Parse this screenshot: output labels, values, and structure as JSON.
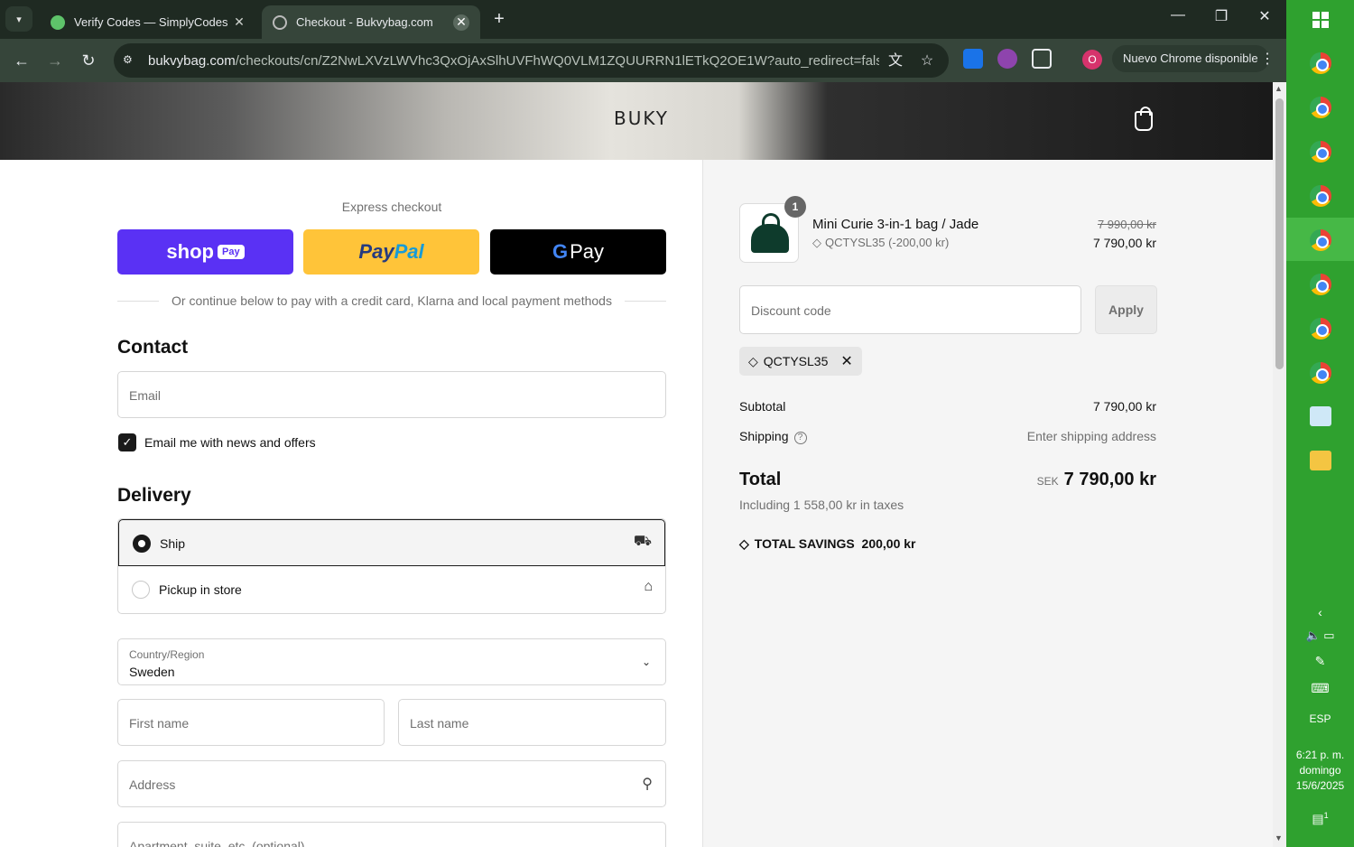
{
  "browser": {
    "tabs": [
      {
        "title": "Verify Codes — SimplyCodes",
        "active": false
      },
      {
        "title": "Checkout - Bukvybag.com",
        "active": true
      }
    ],
    "url_main": "bukvybag.com",
    "url_rest": "/checkouts/cn/Z2NwLXVzLWVhc3QxOjAxSlhUVFhWQ0VLM1ZQUURRN1lETkQ2OE1W?auto_redirect=false&e...",
    "profile_letter": "O",
    "update_label": "Nuevo Chrome disponible"
  },
  "store": {
    "logo": "BUKY"
  },
  "checkout": {
    "express_label": "Express checkout",
    "shop_pay": {
      "shop": "shop",
      "pay": "Pay"
    },
    "paypal": {
      "pay": "Pay",
      "pal": "Pal"
    },
    "gpay": {
      "g": "G",
      "pay": "Pay"
    },
    "divider_text": "Or continue below to pay with a credit card, Klarna and local payment methods",
    "contact_heading": "Contact",
    "email_placeholder": "Email",
    "newsletter_label": "Email me with news and offers",
    "newsletter_checked": true,
    "delivery_heading": "Delivery",
    "delivery_options": [
      {
        "label": "Ship",
        "selected": true
      },
      {
        "label": "Pickup in store",
        "selected": false
      }
    ],
    "country_label": "Country/Region",
    "country_value": "Sweden",
    "first_name_placeholder": "First name",
    "last_name_placeholder": "Last name",
    "address_placeholder": "Address",
    "apartment_placeholder": "Apartment, suite, etc. (optional)"
  },
  "summary": {
    "item": {
      "quantity": "1",
      "name": "Mini Curie 3-in-1 bag / Jade",
      "discount_line": "QCTYSL35 (-200,00 kr)",
      "original_price": "7 990,00 kr",
      "price": "7 790,00 kr"
    },
    "discount_placeholder": "Discount code",
    "apply_label": "Apply",
    "applied_code": "QCTYSL35",
    "subtotal_label": "Subtotal",
    "subtotal_value": "7 790,00 kr",
    "shipping_label": "Shipping",
    "shipping_value": "Enter shipping address",
    "total_label": "Total",
    "currency": "SEK",
    "total_value": "7 790,00 kr",
    "taxes_text": "Including 1 558,00 kr in taxes",
    "savings_label": "TOTAL SAVINGS",
    "savings_value": "200,00 kr"
  },
  "taskbar": {
    "language": "ESP",
    "time": "6:21 p. m.",
    "day": "domingo",
    "date": "15/6/2025",
    "notification_count": "1"
  },
  "colors": {
    "accent_dark": "#1a1a1a",
    "shop_pay": "#5a31f4",
    "paypal": "#ffc439",
    "taskbar": "#2fa12f",
    "browser_frame": "#1f2a22"
  }
}
